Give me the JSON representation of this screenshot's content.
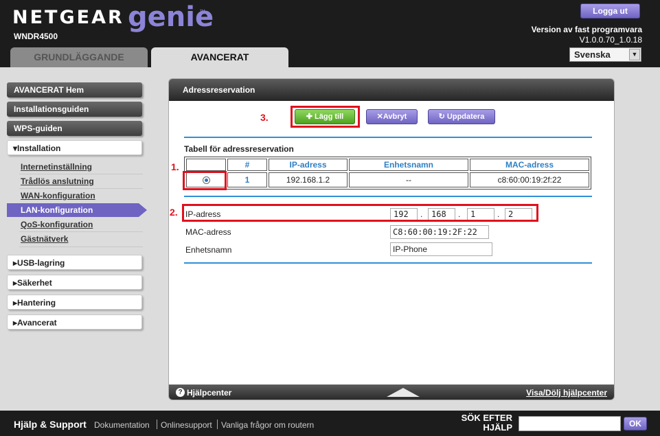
{
  "header": {
    "logo": "NETGEAR",
    "logo_genie": "genie",
    "logo_tm": "™",
    "model": "WNDR4500",
    "logout": "Logga ut",
    "firmware_label": "Version av fast programvara",
    "firmware_version": "V1.0.0.70_1.0.18",
    "language": "Svenska",
    "tabs": [
      {
        "label": "GRUNDLÄGGANDE"
      },
      {
        "label": "AVANCERAT"
      }
    ]
  },
  "sidebar": {
    "items": [
      {
        "label": "AVANCERAT Hem"
      },
      {
        "label": "Installationsguiden"
      },
      {
        "label": "WPS-guiden"
      },
      {
        "label": "▾Installation"
      }
    ],
    "sub_items": [
      {
        "label": "Internetinställning"
      },
      {
        "label": "Trådlös anslutning"
      },
      {
        "label": "WAN-konfiguration"
      },
      {
        "label": "LAN-konfiguration"
      },
      {
        "label": "QoS-konfiguration"
      },
      {
        "label": "Gästnätverk"
      }
    ],
    "groups": [
      {
        "label": "▸USB-lagring"
      },
      {
        "label": "▸Säkerhet"
      },
      {
        "label": "▸Hantering"
      },
      {
        "label": "▸Avancerat"
      }
    ]
  },
  "panel": {
    "title": "Adressreservation",
    "buttons": {
      "add": "✚ Lägg till",
      "cancel": "✕Avbryt",
      "refresh": "↻ Uppdatera"
    },
    "table_title": "Tabell för adressreservation",
    "columns": [
      "#",
      "IP-adress",
      "Enhetsnamn",
      "MAC-adress"
    ],
    "rows": [
      {
        "num": "1",
        "ip": "192.168.1.2",
        "name": "--",
        "mac": "c8:60:00:19:2f:22"
      }
    ],
    "form": {
      "ip_label": "IP-adress",
      "ip_octets": [
        "192",
        "168",
        "1",
        "2"
      ],
      "dot": ".",
      "mac_label": "MAC-adress",
      "mac_value": "C8:60:00:19:2F:22",
      "name_label": "Enhetsnamn",
      "name_value": "IP-Phone"
    },
    "annotations": [
      "1.",
      "2.",
      "3."
    ],
    "help_icon": "?",
    "help_label": "Hjälpcenter",
    "help_toggle": "Visa/Dölj hjälpcenter"
  },
  "support": {
    "title": "Hjälp & Support",
    "links": [
      "Dokumentation",
      "Onlinesupport",
      "Vanliga frågor om routern"
    ],
    "search_label": "SÖK EFTER HJÄLP",
    "ok": "OK"
  },
  "colors": {
    "accent_purple": "#6f64c2",
    "add_green": "#4ea21e",
    "header_blue": "#2f7fc4",
    "annotation_red": "#e0101c"
  }
}
